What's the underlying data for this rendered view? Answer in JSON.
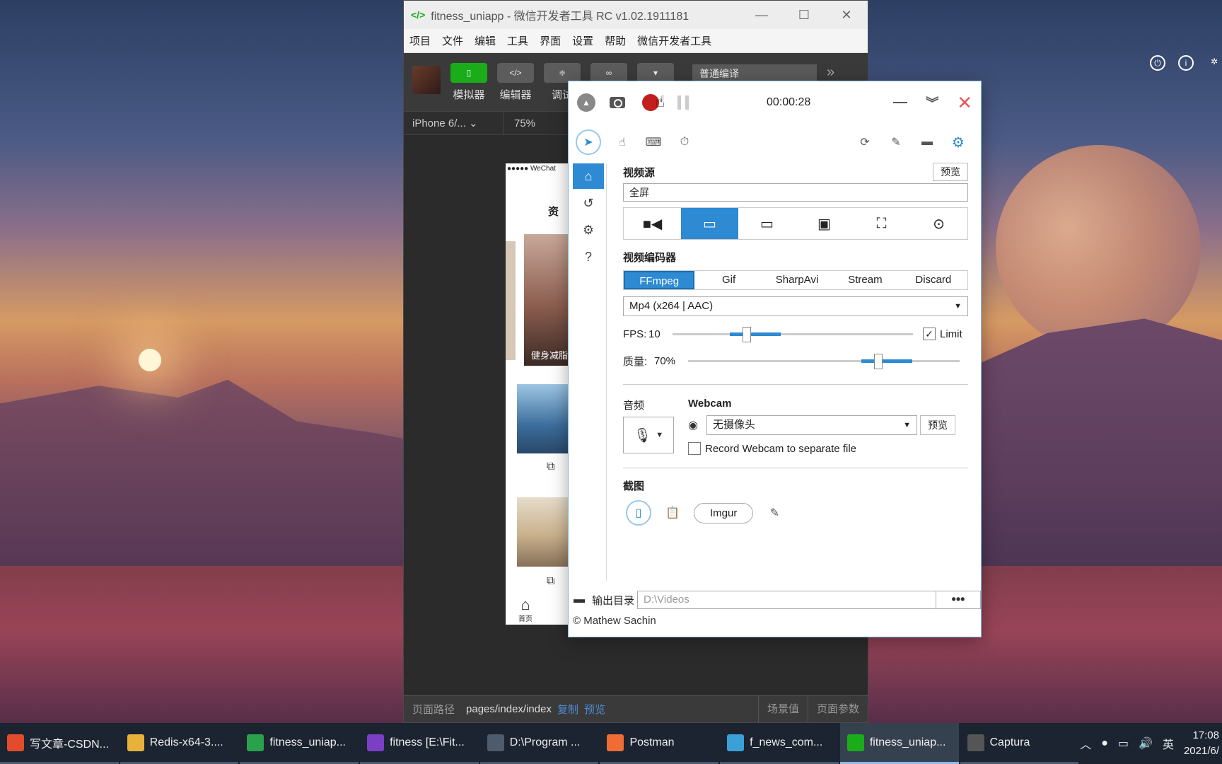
{
  "devtools": {
    "title": "fitness_uniapp - 微信开发者工具 RC v1.02.1911181",
    "menu": [
      "项目",
      "文件",
      "编辑",
      "工具",
      "界面",
      "设置",
      "帮助",
      "微信开发者工具"
    ],
    "tools": [
      "模拟器",
      "编辑器",
      "调试"
    ],
    "compile_mode": "普通编译",
    "device": "iPhone 6/...",
    "zoom": "75%",
    "phone_status": "●●●●● WeChat",
    "phone_heading": "资",
    "phone_card_caption": "健身减脂",
    "phone_tab_label": "首页",
    "footer": {
      "path_label": "页面路径",
      "path": "pages/index/index",
      "copy": "复制",
      "preview": "预览",
      "scene": "场景值",
      "params": "页面参数"
    }
  },
  "captura": {
    "timer": "00:00:28",
    "video_source": {
      "title": "视频源",
      "preview_btn": "预览",
      "value": "全屏"
    },
    "encoder": {
      "title": "视频编码器",
      "tabs": [
        "FFmpeg",
        "Gif",
        "SharpAvi",
        "Stream",
        "Discard"
      ],
      "active_tab": "FFmpeg",
      "format": "Mp4 (x264 | AAC)"
    },
    "fps": {
      "label": "FPS:",
      "value": "10",
      "limit_label": "Limit",
      "limit_checked": true,
      "level": 0.31
    },
    "quality": {
      "label": "质量:",
      "value": "70%",
      "level": 0.7
    },
    "audio": {
      "title": "音频"
    },
    "webcam": {
      "title": "Webcam",
      "device": "无摄像头",
      "preview_btn": "预览",
      "separate_label": "Record Webcam to separate file"
    },
    "screenshot": {
      "title": "截图",
      "imgur": "Imgur"
    },
    "output": {
      "label": "输出目录",
      "path": "D:\\Videos",
      "more": "•••"
    },
    "copyright": "© Mathew Sachin"
  },
  "taskbar": {
    "items": [
      {
        "label": "写文章-CSDN...",
        "icon": "chrome-icon",
        "color": "#e24b2b"
      },
      {
        "label": "Redis-x64-3....",
        "icon": "folder-icon",
        "color": "#e8b23a"
      },
      {
        "label": "fitness_uniap...",
        "icon": "hbuilder-icon",
        "color": "#2aa24b"
      },
      {
        "label": "fitness [E:\\Fit...",
        "icon": "intellij-icon",
        "color": "#7b3fc6"
      },
      {
        "label": "D:\\Program ...",
        "icon": "console-icon",
        "color": "#4d5b6c"
      },
      {
        "label": "Postman",
        "icon": "postman-icon",
        "color": "#ef6c35"
      },
      {
        "label": "f_news_com...",
        "icon": "hbuilder-icon",
        "color": "#3aa0d8"
      },
      {
        "label": "fitness_uniap...",
        "icon": "wechat-devtools-icon",
        "color": "#1aad19"
      },
      {
        "label": "Captura",
        "icon": "captura-icon",
        "color": "#555555"
      }
    ],
    "ime": "英",
    "time": "17:08",
    "date": "2021/6/"
  }
}
